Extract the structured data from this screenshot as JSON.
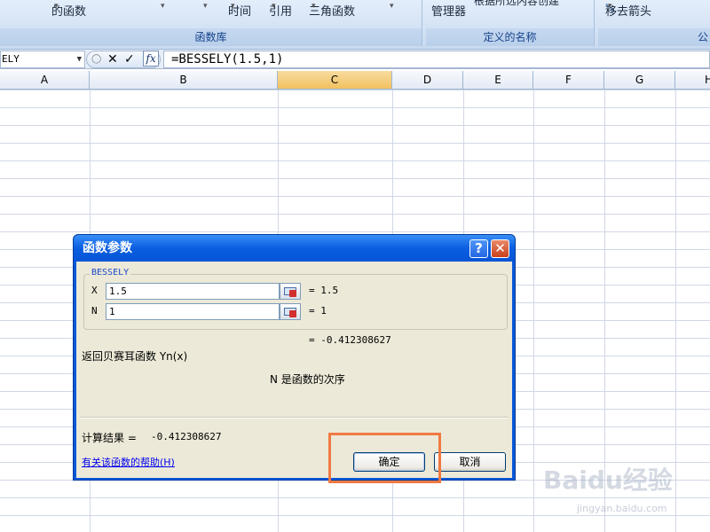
{
  "ribbon": {
    "func_lib": {
      "items": [
        "的函数",
        "时间",
        "引用",
        "三角函数"
      ],
      "label": "函数库"
    },
    "defined_names": {
      "manager": "管理器",
      "create_from_selection": "根据所选内容创建",
      "label": "定义的名称"
    },
    "audit": {
      "remove_arrows": "移去箭头",
      "label": "公"
    }
  },
  "formula_bar": {
    "name_box": "ELY",
    "formula": "=BESSELY(1.5,1)",
    "fx_label": "fx"
  },
  "columns": [
    "A",
    "B",
    "C",
    "D",
    "E",
    "F",
    "G",
    "H"
  ],
  "selected_column": "C",
  "dialog": {
    "title": "函数参数",
    "function_name": "BESSELY",
    "args": [
      {
        "name": "X",
        "value": "1.5",
        "result": "= 1.5"
      },
      {
        "name": "N",
        "value": "1",
        "result": "= 1"
      }
    ],
    "overall_result": "= -0.412308627",
    "description": "返回贝赛耳函数 Yn(x)",
    "arg_description": "N  是函数的次序",
    "calc_result_label": "计算结果 =",
    "calc_result_value": "-0.412308627",
    "help_link": "有关该函数的帮助(H)",
    "ok_label": "确定",
    "cancel_label": "取消"
  },
  "watermark": {
    "brand": "Baidu经验",
    "url": "jingyan.baidu.com"
  }
}
